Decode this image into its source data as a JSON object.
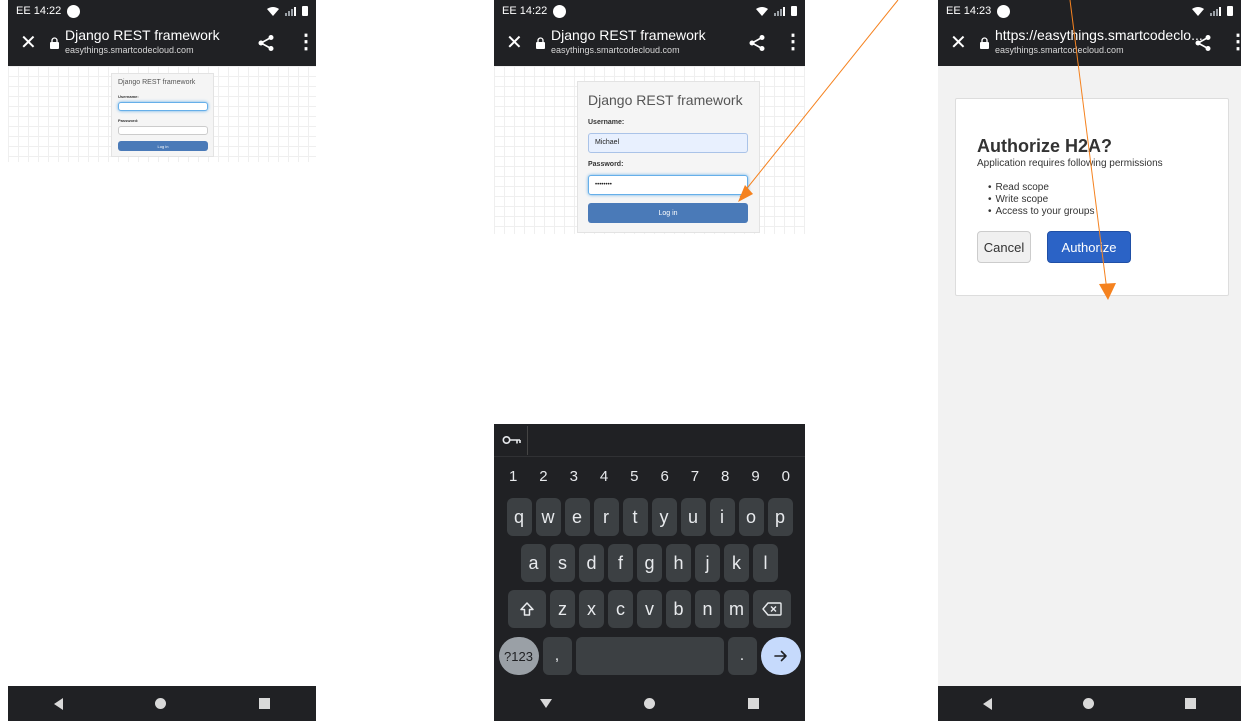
{
  "screens": [
    {
      "status": {
        "time": "EE 14:22"
      },
      "browser": {
        "title": "Django REST framework",
        "url": "easythings.smartcodecloud.com"
      },
      "login": {
        "heading": "Django REST framework",
        "username_label": "Username:",
        "username_value": "",
        "password_label": "Password:",
        "password_value": "",
        "button": "Log in"
      }
    },
    {
      "status": {
        "time": "EE 14:22"
      },
      "browser": {
        "title": "Django REST framework",
        "url": "easythings.smartcodecloud.com"
      },
      "login": {
        "heading": "Django REST framework",
        "username_label": "Username:",
        "username_value": "Michael",
        "password_label": "Password:",
        "password_value": "••••••••",
        "button": "Log in"
      },
      "keyboard": {
        "numbers": [
          "1",
          "2",
          "3",
          "4",
          "5",
          "6",
          "7",
          "8",
          "9",
          "0"
        ],
        "row1": [
          "q",
          "w",
          "e",
          "r",
          "t",
          "y",
          "u",
          "i",
          "o",
          "p"
        ],
        "row2": [
          "a",
          "s",
          "d",
          "f",
          "g",
          "h",
          "j",
          "k",
          "l"
        ],
        "row3": [
          "z",
          "x",
          "c",
          "v",
          "b",
          "n",
          "m"
        ],
        "sym": "?123",
        "comma": ",",
        "dot": "."
      }
    },
    {
      "status": {
        "time": "EE 14:23"
      },
      "browser": {
        "title": "https://easythings.smartcodeclo...",
        "url": "easythings.smartcodecloud.com"
      },
      "auth": {
        "title": "Authorize H2A?",
        "subtitle": "Application requires following permissions",
        "permissions": [
          "Read scope",
          "Write scope",
          "Access to your groups"
        ],
        "cancel": "Cancel",
        "authorize": "Authorize"
      }
    }
  ],
  "colors": {
    "annotation_arrow": "#f5821f",
    "browser_bar": "#202124",
    "authorize_button": "#2b63c6",
    "login_button": "#4a7ab8"
  },
  "icons": [
    "close-icon",
    "lock-icon",
    "share-icon",
    "more-vert-icon",
    "key-icon",
    "shift-icon",
    "backspace-icon",
    "enter-arrow-icon",
    "back-icon",
    "home-icon",
    "recents-icon"
  ]
}
